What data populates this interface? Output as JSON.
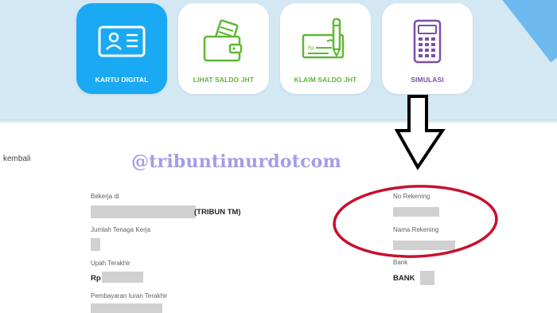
{
  "menu": [
    {
      "label": "KARTU DIGITAL",
      "icon": "id-card-icon",
      "color": "#ffffff",
      "active": true
    },
    {
      "label": "LIHAT SALDO JHT",
      "icon": "wallet-icon",
      "color": "#5fb833",
      "active": false
    },
    {
      "label": "KLAIM SALDO JHT",
      "icon": "cheque-pen-icon",
      "color": "#5fb833",
      "active": false
    },
    {
      "label": "SIMULASI",
      "icon": "calculator-icon",
      "color": "#7b4fa8",
      "active": false
    }
  ],
  "back_text": "kembali",
  "watermark": "@tribuntimurdotcom",
  "left_fields": {
    "employer_label": "Bekerja di",
    "employer_value": "(TRIBUN TM)",
    "workforce_label": "Jumlah Tenaga Kerja",
    "salary_label": "Upah Terakhir",
    "salary_value": "Rp",
    "last_payment_label": "Pembayaran Iuran Terakhir"
  },
  "right_fields": {
    "account_no_label": "No Rekening",
    "account_name_label": "Nama Rekening",
    "bank_label": "Bank",
    "bank_value": "BANK"
  },
  "colors": {
    "accent_blue": "#1aa9f3",
    "band": "#d4e8f4",
    "annotation_red": "#c8102e",
    "watermark": "#a49de6"
  }
}
